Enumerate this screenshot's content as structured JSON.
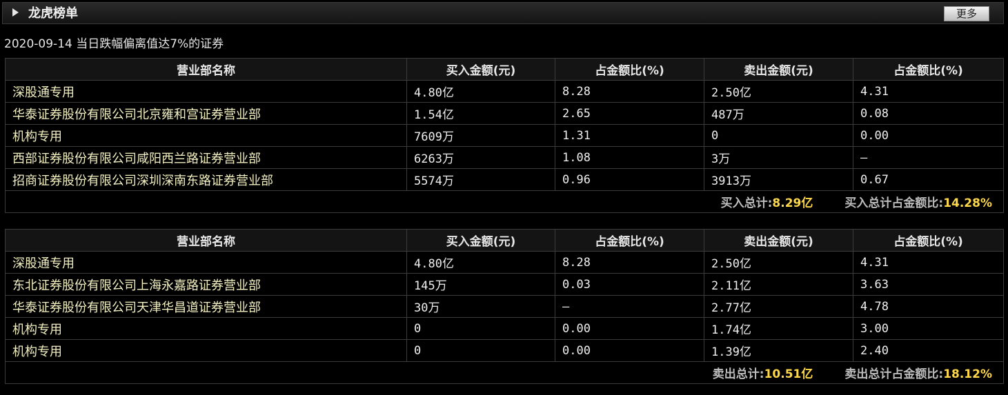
{
  "header": {
    "title": "龙虎榜单",
    "more_label": "更多"
  },
  "subtitle": "2020-09-14 当日跌幅偏离值达7%的证券",
  "columns": [
    "营业部名称",
    "买入金额(元)",
    "占金额比(%)",
    "卖出金额(元)",
    "占金额比(%)"
  ],
  "buy_table": {
    "rows": [
      {
        "name": "深股通专用",
        "buy": "4.80亿",
        "buy_pct": "8.28",
        "sell": "2.50亿",
        "sell_pct": "4.31"
      },
      {
        "name": "华泰证券股份有限公司北京雍和宫证券营业部",
        "buy": "1.54亿",
        "buy_pct": "2.65",
        "sell": "487万",
        "sell_pct": "0.08"
      },
      {
        "name": "机构专用",
        "buy": "7609万",
        "buy_pct": "1.31",
        "sell": "0",
        "sell_pct": "0.00"
      },
      {
        "name": "西部证券股份有限公司咸阳西兰路证券营业部",
        "buy": "6263万",
        "buy_pct": "1.08",
        "sell": "3万",
        "sell_pct": "—"
      },
      {
        "name": "招商证券股份有限公司深圳深南东路证券营业部",
        "buy": "5574万",
        "buy_pct": "0.96",
        "sell": "3913万",
        "sell_pct": "0.67"
      }
    ],
    "total_label": "买入总计:",
    "total_value": "8.29亿",
    "total_pct_label": "买入总计占金额比:",
    "total_pct_value": "14.28%"
  },
  "sell_table": {
    "rows": [
      {
        "name": "深股通专用",
        "buy": "4.80亿",
        "buy_pct": "8.28",
        "sell": "2.50亿",
        "sell_pct": "4.31"
      },
      {
        "name": "东北证券股份有限公司上海永嘉路证券营业部",
        "buy": "145万",
        "buy_pct": "0.03",
        "sell": "2.11亿",
        "sell_pct": "3.63"
      },
      {
        "name": "华泰证券股份有限公司天津华昌道证券营业部",
        "buy": "30万",
        "buy_pct": "—",
        "sell": "2.77亿",
        "sell_pct": "4.78"
      },
      {
        "name": "机构专用",
        "buy": "0",
        "buy_pct": "0.00",
        "sell": "1.74亿",
        "sell_pct": "3.00"
      },
      {
        "name": "机构专用",
        "buy": "0",
        "buy_pct": "0.00",
        "sell": "1.39亿",
        "sell_pct": "2.40"
      }
    ],
    "total_label": "卖出总计:",
    "total_value": "10.51亿",
    "total_pct_label": "卖出总计占金额比:",
    "total_pct_value": "18.12%"
  }
}
